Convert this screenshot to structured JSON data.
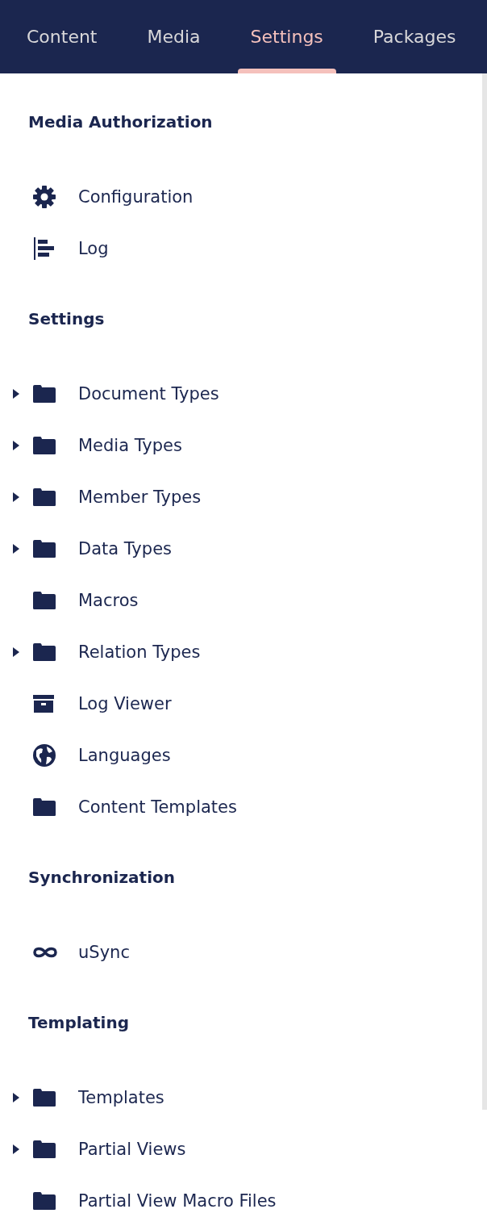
{
  "tabs": [
    {
      "label": "Content",
      "selected": false
    },
    {
      "label": "Media",
      "selected": false
    },
    {
      "label": "Settings",
      "selected": true
    },
    {
      "label": "Packages",
      "selected": false
    }
  ],
  "sections": [
    {
      "title": "Media Authorization",
      "items": [
        {
          "label": "Configuration",
          "kind": "gear",
          "expandable": false
        },
        {
          "label": "Log",
          "kind": "log",
          "expandable": false
        }
      ]
    },
    {
      "title": "Settings",
      "items": [
        {
          "label": "Document Types",
          "kind": "folder",
          "expandable": true
        },
        {
          "label": "Media Types",
          "kind": "folder",
          "expandable": true
        },
        {
          "label": "Member Types",
          "kind": "folder",
          "expandable": true
        },
        {
          "label": "Data Types",
          "kind": "folder",
          "expandable": true
        },
        {
          "label": "Macros",
          "kind": "folder",
          "expandable": false
        },
        {
          "label": "Relation Types",
          "kind": "folder",
          "expandable": true
        },
        {
          "label": "Log Viewer",
          "kind": "archive",
          "expandable": false
        },
        {
          "label": "Languages",
          "kind": "globe",
          "expandable": false
        },
        {
          "label": "Content Templates",
          "kind": "folder",
          "expandable": false
        }
      ]
    },
    {
      "title": "Synchronization",
      "items": [
        {
          "label": "uSync",
          "kind": "infinity",
          "expandable": false
        }
      ]
    },
    {
      "title": "Templating",
      "items": [
        {
          "label": "Templates",
          "kind": "folder",
          "expandable": true
        },
        {
          "label": "Partial Views",
          "kind": "folder",
          "expandable": true
        },
        {
          "label": "Partial View Macro Files",
          "kind": "folder",
          "expandable": false
        }
      ]
    }
  ]
}
